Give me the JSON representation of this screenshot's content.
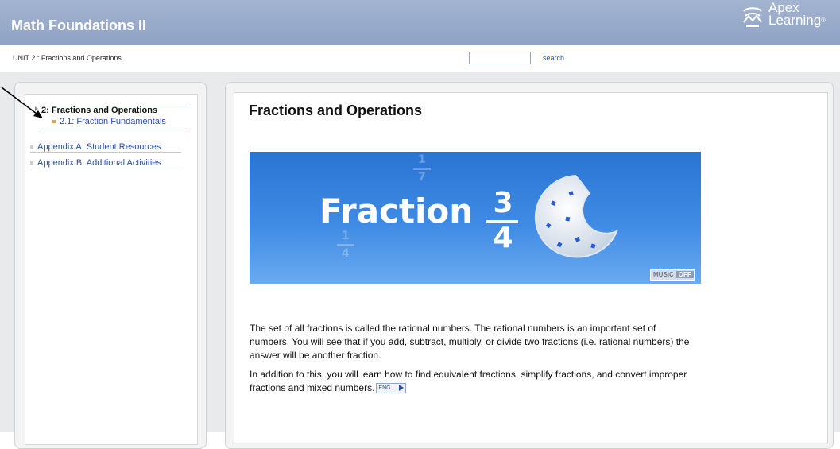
{
  "app": {
    "title": "Math Foundations II",
    "logo": {
      "line1": "Apex",
      "line2": "Learning",
      "reg": "®",
      "icon": "apex-logo-icon"
    }
  },
  "breadcrumb": "UNIT 2 : Fractions and Operations",
  "search": {
    "value": "",
    "link_label": "search"
  },
  "nav": {
    "unit_title": "2: Fractions and Operations",
    "unit_sub": "2.1: Fraction Fundamentals",
    "appendices": [
      "Appendix A: Student Resources",
      "Appendix B: Additional Activities"
    ]
  },
  "content": {
    "title": "Fractions and Operations",
    "banner": {
      "word": "Fraction",
      "numerator": "3",
      "denominator": "4",
      "bg_fraction_a": {
        "numerator": "1",
        "denominator": "7"
      },
      "bg_fraction_b": {
        "numerator": "1",
        "denominator": "4"
      },
      "music_label": "MUSIC",
      "music_state": "OFF"
    },
    "paragraphs": [
      "The set of all fractions is called the rational numbers. The rational numbers is an important set of numbers. You will see that if you add, subtract, multiply, or divide two fractions (i.e. rational numbers) the answer will be another fraction.",
      "In addition to this, you will learn how to find equivalent fractions, simplify fractions, and convert improper fractions and mixed numbers."
    ],
    "audio_label": "ENG"
  },
  "colors": {
    "topbar": "#98aac9",
    "link": "#2a4fa8",
    "accent": "#e7a44c",
    "banner": "#3f8be4"
  }
}
